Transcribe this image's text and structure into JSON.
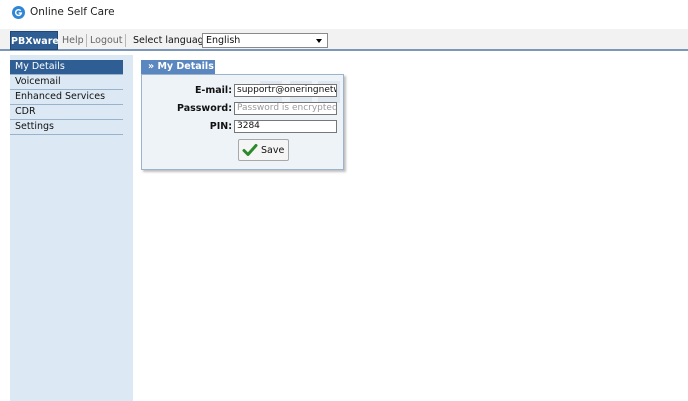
{
  "app": {
    "title": "Online Self Care",
    "brand_color": "#2f86d6"
  },
  "top_bar": {
    "tabs": [
      {
        "label": "PBXware",
        "active": true
      },
      {
        "label": "Help"
      },
      {
        "label": "Logout"
      }
    ],
    "language": {
      "label": "Select language:",
      "value": "English"
    }
  },
  "sidebar": {
    "items": [
      {
        "label": "My Details",
        "active": true
      },
      {
        "label": "Voicemail"
      },
      {
        "label": "Enhanced Services"
      },
      {
        "label": "CDR"
      },
      {
        "label": "Settings"
      }
    ]
  },
  "panel": {
    "title": "» My Details",
    "fields": {
      "email": {
        "label": "E-mail:",
        "value": "supportr@oneringnetwor"
      },
      "password": {
        "label": "Password:",
        "placeholder": "Password is encrypted."
      },
      "pin": {
        "label": "PIN:",
        "value": "3284"
      }
    },
    "save_label": "Save"
  },
  "colors": {
    "accent": "#2e5e94",
    "sidebar_bg": "#dce9f5",
    "panel_tab": "#5a87bf"
  },
  "icons": {
    "app_logo": "g-logo-icon",
    "save": "checkmark-icon",
    "dropdown": "chevron-down-icon"
  }
}
